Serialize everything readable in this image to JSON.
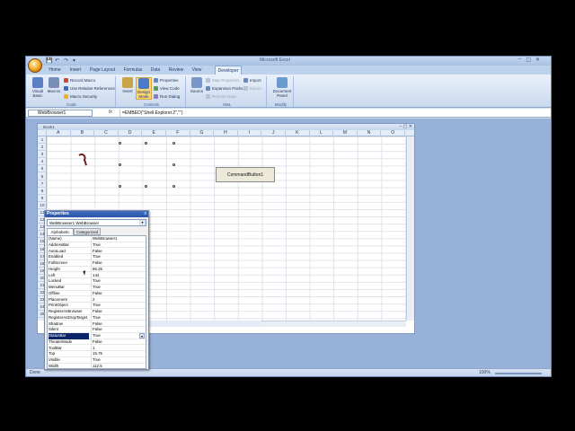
{
  "app": {
    "title": "Microsoft Excel",
    "qat_save": "💾",
    "qat_undo": "↶",
    "qat_redo": "↷",
    "qat_more": "▾"
  },
  "window_controls": {
    "minimize": "–",
    "maximize": "▢",
    "close": "✕"
  },
  "tabs": [
    "Home",
    "Insert",
    "Page Layout",
    "Formulas",
    "Data",
    "Review",
    "View",
    "Developer"
  ],
  "ribbon": {
    "code": {
      "label": "Code",
      "visual_basic": "Visual Basic",
      "macros": "Macros",
      "record_macro": "Record Macro",
      "relative_refs": "Use Relative References",
      "macro_security": "Macro Security"
    },
    "controls": {
      "label": "Controls",
      "insert": "Insert",
      "design_mode": "Design Mode",
      "properties": "Properties",
      "view_code": "View Code",
      "run_dialog": "Run Dialog"
    },
    "xml": {
      "label": "XML",
      "source": "Source",
      "map_properties": "Map Properties",
      "expansion_packs": "Expansion Packs",
      "refresh_data": "Refresh Data",
      "import": "Import",
      "export": "Export"
    },
    "modify": {
      "label": "Modify",
      "document_panel": "Document Panel"
    }
  },
  "formula_bar": {
    "name_box": "WebBrowser1",
    "fx": "fx",
    "formula": "=EMBED(\"Shell.Explorer.2\",\"\")"
  },
  "workbook": {
    "title": "Book1",
    "columns": [
      "A",
      "B",
      "C",
      "D",
      "E",
      "F",
      "G",
      "H",
      "I",
      "J",
      "K",
      "L",
      "M",
      "N",
      "O"
    ],
    "rows": [
      "1",
      "2",
      "3",
      "4",
      "5",
      "6",
      "7",
      "8",
      "9",
      "10",
      "11",
      "12",
      "13",
      "14",
      "15",
      "16",
      "17",
      "18",
      "19",
      "20",
      "21",
      "22",
      "23",
      "24",
      "25"
    ],
    "command_button": "CommandButton1"
  },
  "status_bar": {
    "left": "Done",
    "zoom": "100%"
  },
  "properties": {
    "title": "Properties",
    "close": "x",
    "object": "WebBrowser1 WebBrowser",
    "tab_alphabetic": "Alphabetic",
    "tab_categorized": "Categorized",
    "rows": [
      {
        "name": "(Name)",
        "value": "WebBrowser1"
      },
      {
        "name": "AddressBar",
        "value": "True"
      },
      {
        "name": "AutoLoad",
        "value": "False"
      },
      {
        "name": "Enabled",
        "value": "True"
      },
      {
        "name": "FullScreen",
        "value": "False"
      },
      {
        "name": "Height",
        "value": "86.25"
      },
      {
        "name": "Left",
        "value": "144"
      },
      {
        "name": "Locked",
        "value": "True"
      },
      {
        "name": "MenuBar",
        "value": "True"
      },
      {
        "name": "Offline",
        "value": "False"
      },
      {
        "name": "Placement",
        "value": "2"
      },
      {
        "name": "PrintObject",
        "value": "True"
      },
      {
        "name": "RegisterAsBrowser",
        "value": "False"
      },
      {
        "name": "RegisterAsDropTarget",
        "value": "True"
      },
      {
        "name": "Shadow",
        "value": "False"
      },
      {
        "name": "Silent",
        "value": "False"
      },
      {
        "name": "StatusBar",
        "value": "True"
      },
      {
        "name": "TheaterMode",
        "value": "False"
      },
      {
        "name": "ToolBar",
        "value": "1"
      },
      {
        "name": "Top",
        "value": "15.75"
      },
      {
        "name": "Visible",
        "value": "True"
      },
      {
        "name": "Width",
        "value": "112.5"
      }
    ],
    "selected_index": 16
  }
}
